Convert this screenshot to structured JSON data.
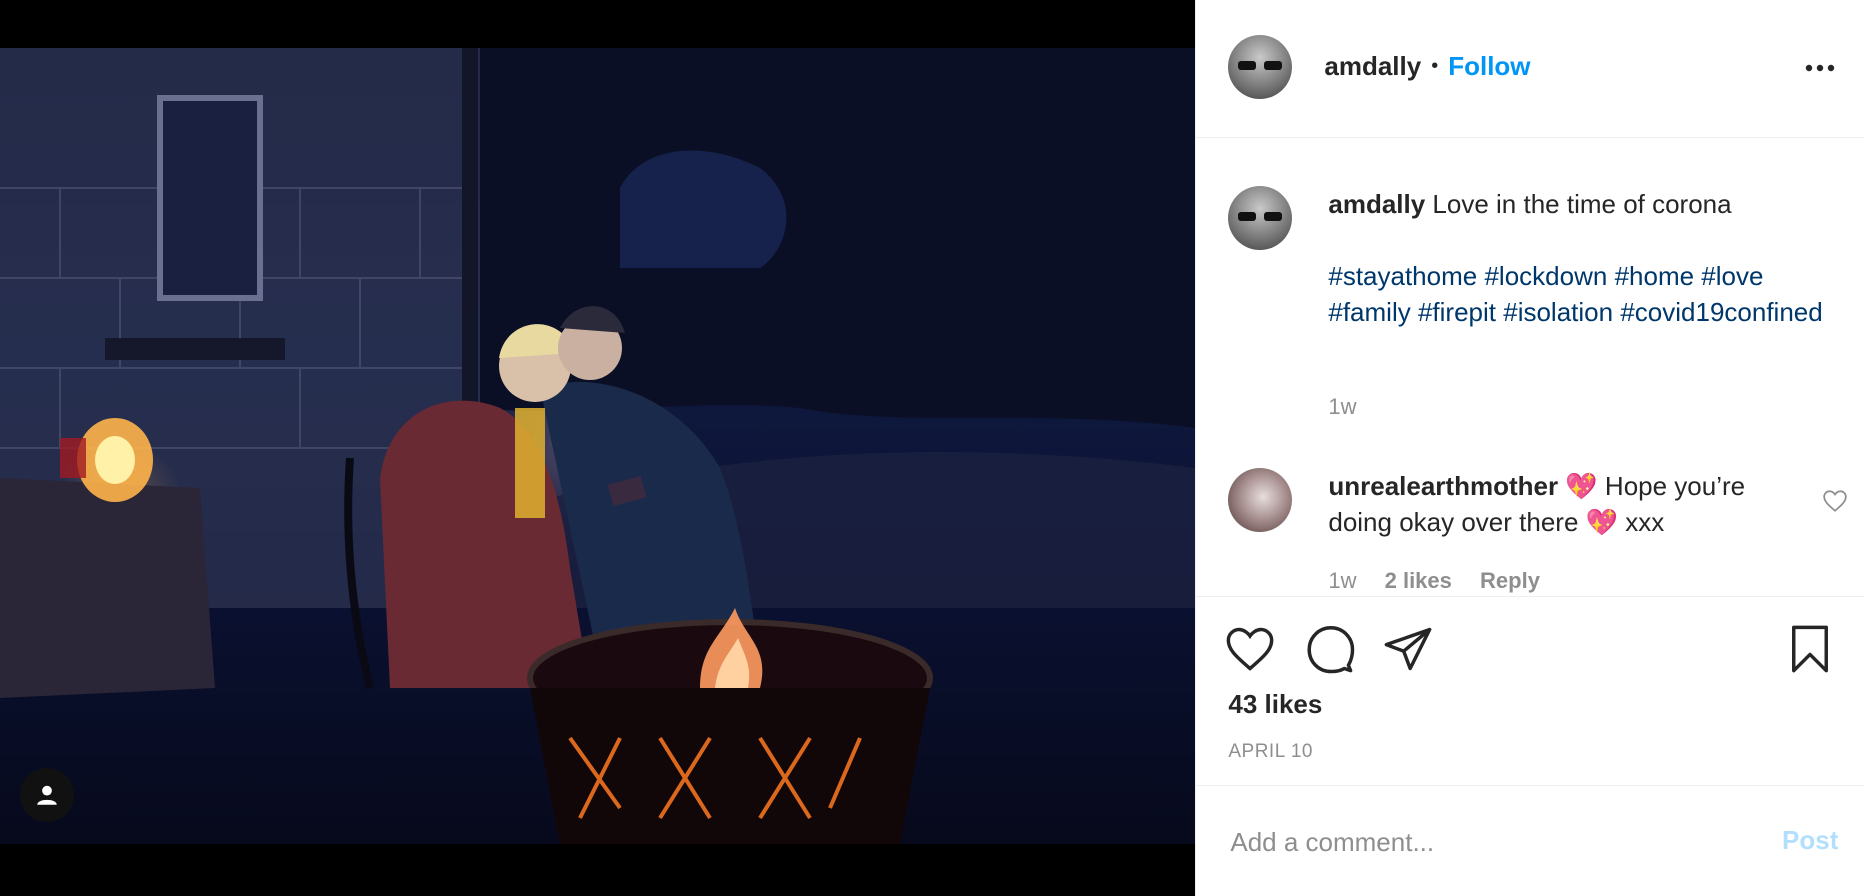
{
  "post": {
    "username": "amdally",
    "separator": "•",
    "follow_label": "Follow",
    "caption_text": "Love in the time of corona",
    "hashtags": [
      "#stayathome",
      "#lockdown",
      "#home",
      "#love",
      "#family",
      "#firepit",
      "#isolation",
      "#covid19confined"
    ],
    "caption_time": "1w",
    "likes": "43 likes",
    "date": "APRIL 10"
  },
  "comments": [
    {
      "username": "unrealearthmother",
      "text": "💖  Hope you’re doing okay over there 💖  xxx",
      "time": "1w",
      "likes": "2 likes",
      "reply_label": "Reply"
    }
  ],
  "add_comment": {
    "placeholder": "Add a comment...",
    "post_label": "Post"
  },
  "icons": {
    "more": "more-options-icon",
    "like": "heart-icon",
    "comment": "comment-bubble-icon",
    "share": "paper-plane-icon",
    "save": "bookmark-icon",
    "tag": "user-tag-icon"
  },
  "colors": {
    "link_blue": "#0095f6",
    "hashtag": "#00376b",
    "muted": "#8e8e8e",
    "post_disabled": "#b2dffc"
  }
}
